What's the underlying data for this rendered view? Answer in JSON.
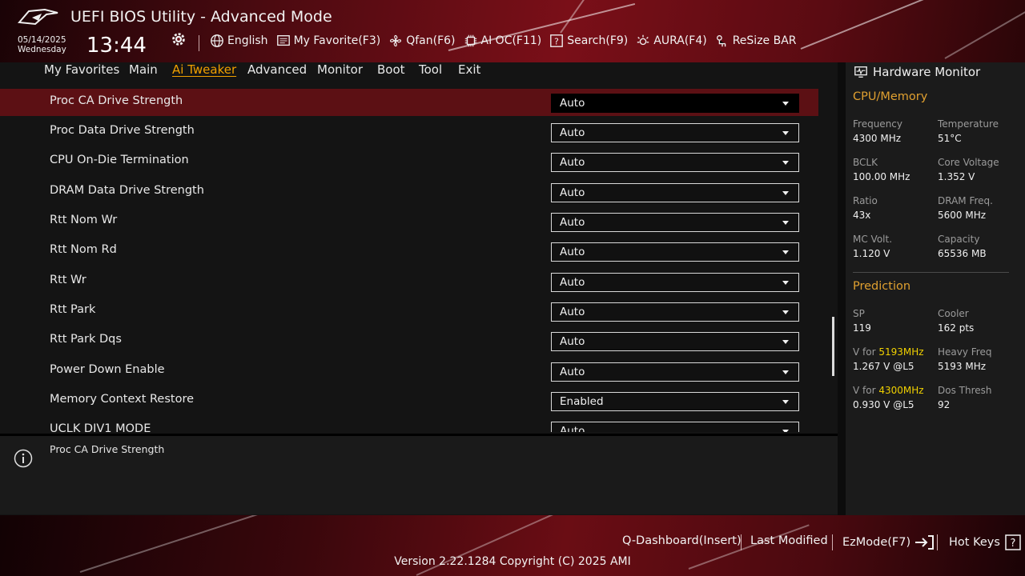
{
  "header": {
    "title": "UEFI BIOS Utility - Advanced Mode",
    "date": "05/14/2025",
    "weekday": "Wednesday",
    "time": "13:44",
    "toolbar": {
      "language": "English",
      "favorite": "My Favorite(F3)",
      "qfan": "Qfan(F6)",
      "ai_oc": "AI OC(F11)",
      "search": "Search(F9)",
      "aura": "AURA(F4)",
      "resize_bar": "ReSize BAR"
    }
  },
  "nav": {
    "tabs": [
      {
        "label": "My Favorites"
      },
      {
        "label": "Main"
      },
      {
        "label": "Ai Tweaker"
      },
      {
        "label": "Advanced"
      },
      {
        "label": "Monitor"
      },
      {
        "label": "Boot"
      },
      {
        "label": "Tool"
      },
      {
        "label": "Exit"
      }
    ],
    "active": "Ai Tweaker"
  },
  "settings": [
    {
      "label": "Proc CA Drive Strength",
      "value": "Auto"
    },
    {
      "label": "Proc Data Drive Strength",
      "value": "Auto"
    },
    {
      "label": "CPU On-Die Termination",
      "value": "Auto"
    },
    {
      "label": "DRAM Data Drive Strength",
      "value": "Auto"
    },
    {
      "label": "Rtt Nom Wr",
      "value": "Auto"
    },
    {
      "label": "Rtt Nom Rd",
      "value": "Auto"
    },
    {
      "label": "Rtt Wr",
      "value": "Auto"
    },
    {
      "label": "Rtt Park",
      "value": "Auto"
    },
    {
      "label": "Rtt Park Dqs",
      "value": "Auto"
    },
    {
      "label": "Power Down Enable",
      "value": "Auto"
    },
    {
      "label": "Memory Context Restore",
      "value": "Enabled"
    },
    {
      "label": "UCLK DIV1 MODE",
      "value": "Auto"
    }
  ],
  "help": {
    "text": "Proc CA Drive Strength"
  },
  "hardware_monitor": {
    "title": "Hardware Monitor",
    "cpu_memory": {
      "title": "CPU/Memory",
      "frequency_label": "Frequency",
      "frequency": "4300 MHz",
      "temperature_label": "Temperature",
      "temperature": "51°C",
      "bclk_label": "BCLK",
      "bclk": "100.00 MHz",
      "core_voltage_label": "Core Voltage",
      "core_voltage": "1.352 V",
      "ratio_label": "Ratio",
      "ratio": "43x",
      "dram_freq_label": "DRAM Freq.",
      "dram_freq": "5600 MHz",
      "mc_volt_label": "MC Volt.",
      "mc_volt": "1.120 V",
      "capacity_label": "Capacity",
      "capacity": "65536 MB"
    },
    "prediction": {
      "title": "Prediction",
      "sp_label": "SP",
      "sp": "119",
      "cooler_label": "Cooler",
      "cooler": "162 pts",
      "v_for_label": "V for",
      "v_for_1_freq": "5193MHz",
      "v_for_1": "1.267 V @L5",
      "heavy_freq_label": "Heavy Freq",
      "heavy_freq": "5193 MHz",
      "v_for_2_freq": "4300MHz",
      "v_for_2": "0.930 V @L5",
      "dos_thresh_label": "Dos Thresh",
      "dos_thresh": "92"
    }
  },
  "footer": {
    "q_dashboard": "Q-Dashboard(Insert)",
    "last_modified": "Last Modified",
    "ezmode": "EzMode(F7)",
    "hot_keys": "Hot Keys",
    "version": "Version 2.22.1284 Copyright (C) 2025 AMI"
  },
  "colors": {
    "accent": "#f0a000",
    "selected_row": "#5c1014",
    "highlight_freq": "#f0d000",
    "header_red": "#7a0f18"
  }
}
